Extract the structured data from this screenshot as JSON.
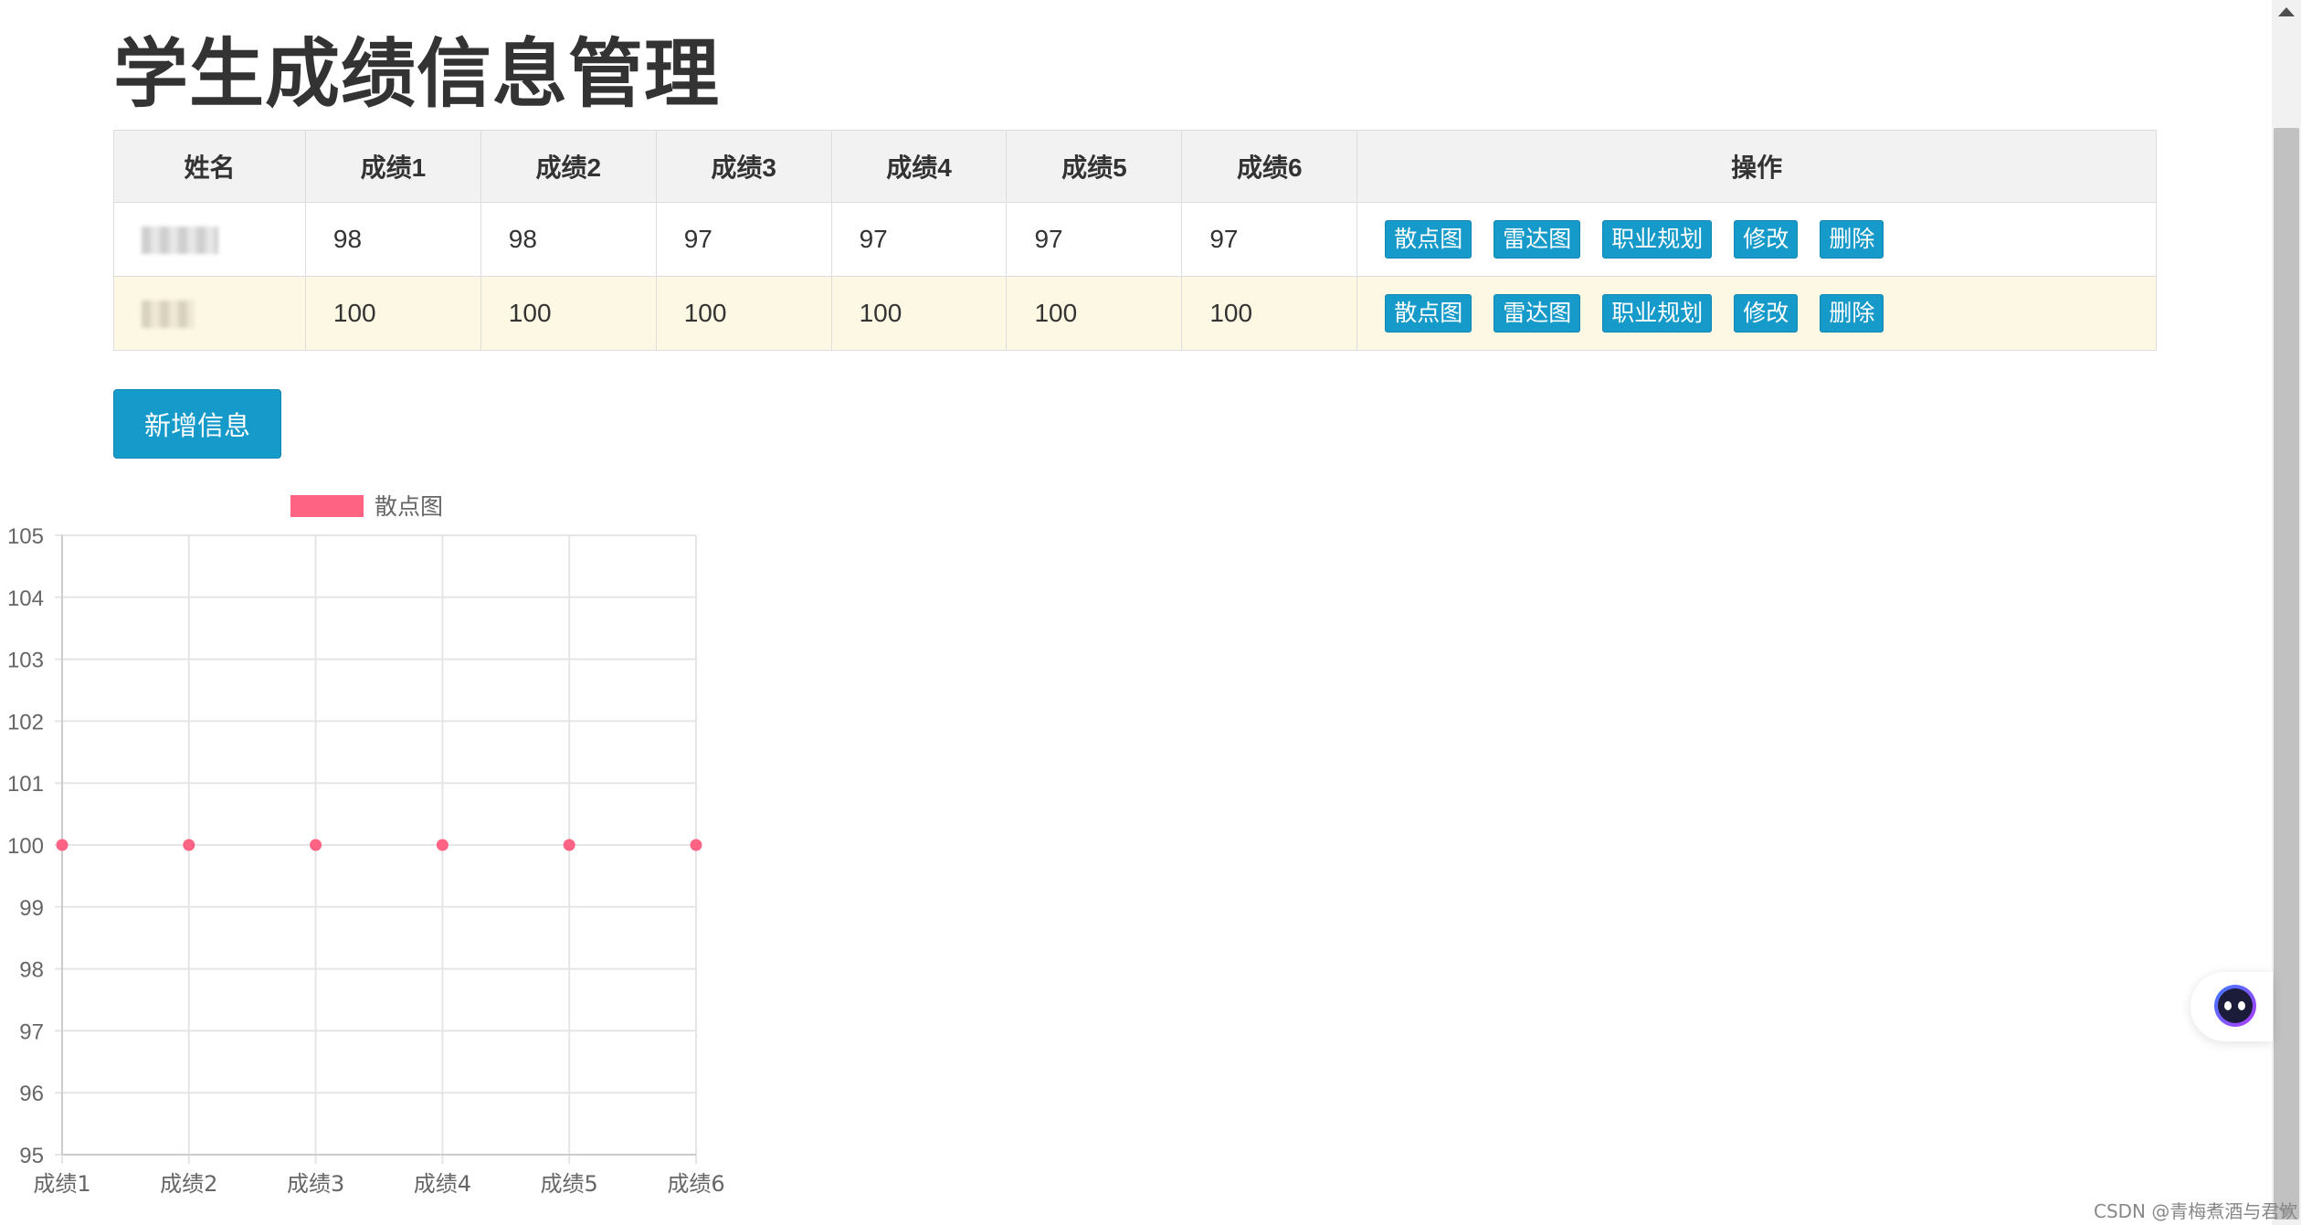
{
  "page": {
    "title": "学生成绩信息管理"
  },
  "table": {
    "headers": [
      "姓名",
      "成绩1",
      "成绩2",
      "成绩3",
      "成绩4",
      "成绩5",
      "成绩6",
      "操作"
    ],
    "rows": [
      {
        "scores": [
          "98",
          "98",
          "97",
          "97",
          "97",
          "97"
        ]
      },
      {
        "scores": [
          "100",
          "100",
          "100",
          "100",
          "100",
          "100"
        ]
      }
    ],
    "actions": {
      "scatter": "散点图",
      "radar": "雷达图",
      "career": "职业规划",
      "edit": "修改",
      "delete": "删除"
    }
  },
  "add_button": "新增信息",
  "chart_data": {
    "type": "scatter",
    "categories": [
      "成绩1",
      "成绩2",
      "成绩3",
      "成绩4",
      "成绩5",
      "成绩6"
    ],
    "series": [
      {
        "name": "散点图",
        "color": "#ff6384",
        "values": [
          100,
          100,
          100,
          100,
          100,
          100
        ]
      }
    ],
    "ylim": [
      95,
      105
    ],
    "yticks": [
      95,
      96,
      97,
      98,
      99,
      100,
      101,
      102,
      103,
      104,
      105
    ],
    "grid": true,
    "legend": "top-center"
  },
  "watermark": "CSDN @青梅煮酒与君饮"
}
